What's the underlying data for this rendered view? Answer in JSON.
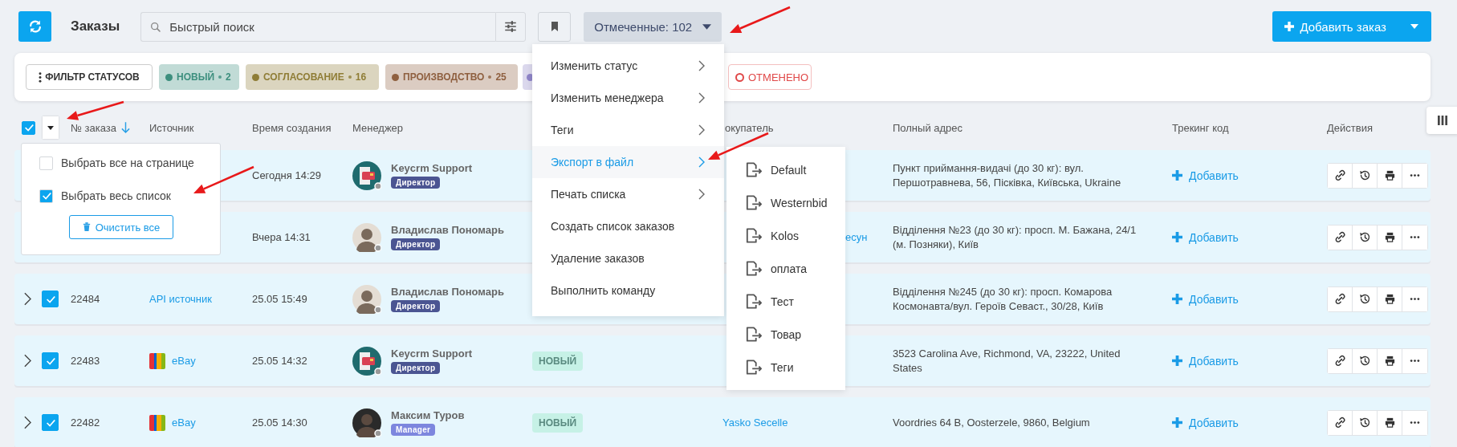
{
  "header": {
    "title": "Заказы",
    "search": {
      "placeholder": "Быстрый поиск"
    },
    "marked_button": "Отмеченные: 102",
    "add_button": "Добавить заказ"
  },
  "status_filter": {
    "label": "ФИЛЬТР СТАТУСОВ",
    "chips": [
      {
        "kind": "filled",
        "label": "НОВЫЙ",
        "count": "2",
        "color": "#3d8f7e"
      },
      {
        "kind": "filled",
        "label": "СОГЛАСОВАНИЕ",
        "count": "16",
        "color": "#8f7d36"
      },
      {
        "kind": "filled",
        "label": "ПРОИЗВОДСТВО",
        "count": "25",
        "color": "#8f6040"
      },
      {
        "kind": "covered",
        "color": "#8f85c8"
      },
      {
        "kind": "outline",
        "label": "ОТМЕНЕНО",
        "color": "#e04848"
      }
    ]
  },
  "table": {
    "select_all_checked": true,
    "columns": [
      "№ заказа",
      "Источник",
      "Время создания",
      "Менеджер",
      "окупатель",
      "Полный адрес",
      "Трекинг код",
      "Действия"
    ],
    "rows": [
      {
        "time": "Сегодня 14:29",
        "manager": {
          "name": "Keycrm Support",
          "role": "Директор",
          "color": "#4b5592",
          "kind": "logo"
        },
        "address": "Пункт приймання-видачі (до 30 кг): вул. Першотравнева, 56, Пісківка, Київська, Ukraine",
        "tracking": "Добавить"
      },
      {
        "time": "Вчера 14:31",
        "manager": {
          "name": "Владислав Пономарь",
          "role": "Директор",
          "color": "#4b5592",
          "kind": "person"
        },
        "buyer": "есун",
        "address": "Відділення №23 (до 30 кг): просп. М. Бажана, 24/1 (м. Позняки), Київ",
        "tracking": "Добавить"
      },
      {
        "checked": true,
        "number": "22484",
        "source": {
          "kind": "api",
          "label": "API источник"
        },
        "time": "25.05 15:49",
        "manager": {
          "name": "Владислав Пономарь",
          "role": "Директор",
          "color": "#4b5592",
          "kind": "person"
        },
        "address": "Відділення №245 (до 30 кг): просп. Комарова Космонавта/вул. Героїв Севаст., 30/28, Київ",
        "tracking": "Добавить"
      },
      {
        "checked": true,
        "number": "22483",
        "source": {
          "kind": "ebay",
          "label": "eBay"
        },
        "time": "25.05 14:32",
        "manager": {
          "name": "Keycrm Support",
          "role": "Директор",
          "color": "#4b5592",
          "kind": "logo"
        },
        "status": "НОВЫЙ",
        "address": "3523 Carolina Ave, Richmond, VA, 23222, United States",
        "tracking": "Добавить"
      },
      {
        "checked": true,
        "number": "22482",
        "source": {
          "kind": "ebay",
          "label": "eBay"
        },
        "time": "25.05 14:30",
        "manager": {
          "name": "Максим Туров",
          "role": "Manager",
          "color": "#7d86de",
          "kind": "dark-person"
        },
        "status": "НОВЫЙ",
        "buyer": "Yasko Secelle",
        "address": "Voordries 64 B, Oosterzele, 9860, Belgium",
        "tracking": "Добавить"
      }
    ]
  },
  "select_popup": {
    "options": [
      {
        "label": "Выбрать все на странице",
        "checked": false
      },
      {
        "label": "Выбрать весь список",
        "checked": true
      }
    ],
    "clear_button": "Очистить все"
  },
  "actions_menu": {
    "items": [
      {
        "label": "Изменить статус",
        "submenu": true,
        "selected": false
      },
      {
        "label": "Изменить менеджера",
        "submenu": true,
        "selected": false
      },
      {
        "label": "Теги",
        "submenu": true,
        "selected": false
      },
      {
        "label": "Экспорт в файл",
        "submenu": true,
        "selected": true
      },
      {
        "label": "Печать списка",
        "submenu": true,
        "selected": false
      },
      {
        "label": "Создать список заказов",
        "submenu": false,
        "selected": false
      },
      {
        "label": "Удаление заказов",
        "submenu": false,
        "selected": false
      },
      {
        "label": "Выполнить команду",
        "submenu": false,
        "selected": false
      }
    ]
  },
  "export_submenu": {
    "items": [
      "Default",
      "Westernbid",
      "Kolos",
      "оплата",
      "Тест",
      "Товар",
      "Теги"
    ]
  }
}
